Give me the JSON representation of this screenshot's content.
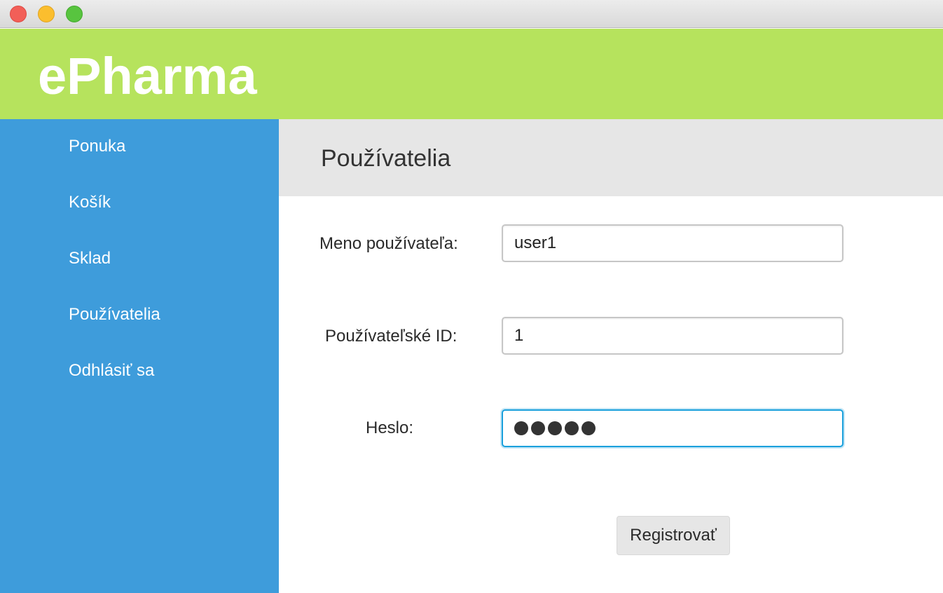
{
  "window": {
    "controls": [
      "close",
      "minimize",
      "maximize"
    ]
  },
  "header": {
    "app_title": "ePharma",
    "color": "#b6e35d"
  },
  "sidebar": {
    "color": "#3e9cdb",
    "items": [
      {
        "label": "Ponuka"
      },
      {
        "label": "Košík"
      },
      {
        "label": "Sklad"
      },
      {
        "label": "Používatelia"
      },
      {
        "label": "Odhlásiť sa"
      }
    ]
  },
  "main": {
    "title": "Používatelia",
    "form": {
      "username_label": "Meno používateľa:",
      "username_value": "user1",
      "userid_label": "Používateľské ID:",
      "userid_value": "1",
      "password_label": "Heslo:",
      "password_masked_length": 5,
      "submit_label": "Registrovať"
    }
  },
  "colors": {
    "accent_focus": "#1aa0dc",
    "content_header_bg": "#e6e6e6"
  }
}
